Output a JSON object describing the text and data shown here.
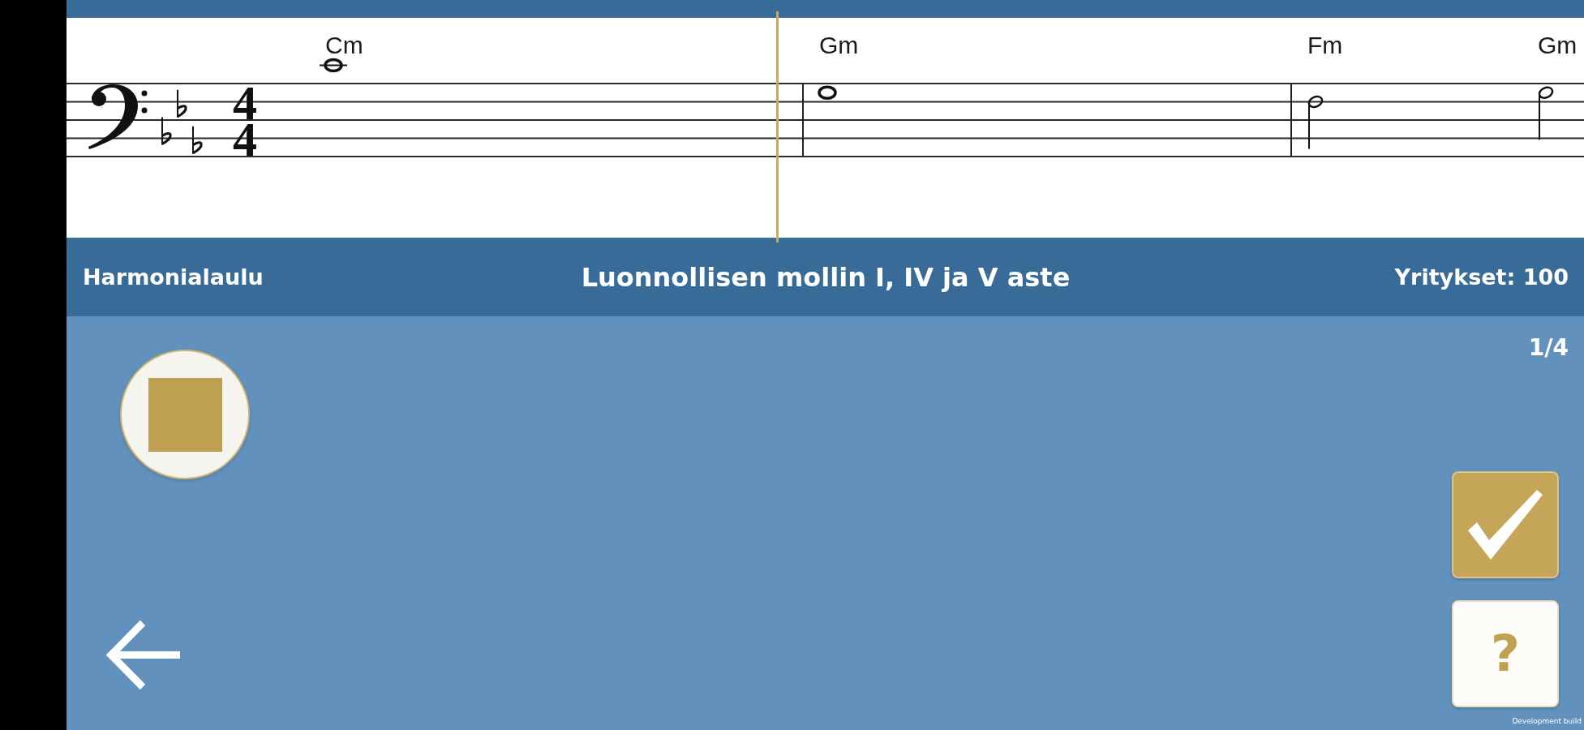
{
  "score": {
    "clef": {
      "kind": "bass"
    },
    "key_signature": [
      {
        "kind": "flat"
      },
      {
        "kind": "flat"
      },
      {
        "kind": "flat"
      }
    ],
    "time_signature": {
      "beats": "4",
      "beat_unit": "4"
    },
    "measures": [
      {
        "notes": [
          {
            "chord": "Cm",
            "kind": "whole"
          }
        ]
      },
      {
        "notes": [
          {
            "chord": "Gm",
            "kind": "whole"
          }
        ]
      },
      {
        "notes": [
          {
            "chord": "Fm",
            "kind": "half"
          },
          {
            "chord": "Gm",
            "kind": "half"
          }
        ]
      }
    ]
  },
  "header": {
    "mode": "Harmonialaulu",
    "title": "Luonnollisen mollin I, IV ja V aste",
    "attempts": "Yritykset: 100"
  },
  "exercise": {
    "progress": "1/4",
    "playback_button": {
      "playing": true
    },
    "help_button": {
      "label": "?"
    },
    "build_label": "Development build"
  }
}
